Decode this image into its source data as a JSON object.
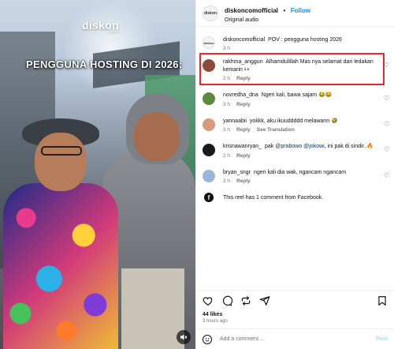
{
  "media": {
    "brand": "diskon",
    "brand_suffix": ".com",
    "overlay_text": "PENGGUNA HOSTING DI 2026:"
  },
  "header": {
    "avatar_text": "diskon",
    "username": "diskoncomofficial",
    "separator": "•",
    "follow_label": "Follow",
    "audio": "Original audio"
  },
  "caption": {
    "avatar_text": "diskon",
    "username": "diskoncomofficial",
    "text": "POV : pengguna hosting 2026",
    "time": "3 h"
  },
  "comments": [
    {
      "username": "rakhma_anggun",
      "text": "Alhamdulillah Mas nya selamat dari ledakan kemarin 👀",
      "time": "2 h",
      "reply": "Reply",
      "translation": "",
      "highlighted": true,
      "avatar_color": "#8a4b3a"
    },
    {
      "username": "novredha_dna",
      "text": "Ngeri kali, bawa sajam 😂😂",
      "time": "3 h",
      "reply": "Reply",
      "translation": "",
      "highlighted": false,
      "avatar_color": "#5d8a3a"
    },
    {
      "username": "yannaabii",
      "text": "yokkk, aku ikuuddddd melawann 🤣",
      "time": "3 h",
      "reply": "Reply",
      "translation": "See Translation",
      "highlighted": false,
      "avatar_color": "#d89a7a"
    },
    {
      "username": "krisnawanryan_",
      "text_before": "pak ",
      "mention1": "@prabowo",
      "mention2": "@jokowi",
      "text_after": ", ini pak di sindir..🔥",
      "time": "2 h",
      "reply": "Reply",
      "translation": "",
      "highlighted": false,
      "avatar_color": "#1a1a1a"
    },
    {
      "username": "bryan_sngr",
      "text": "ngeri kali dia wak, ngancam ngancam",
      "time": "3 h",
      "reply": "Reply",
      "translation": "",
      "highlighted": false,
      "avatar_color": "#9ab7d8"
    }
  ],
  "facebook_note": "This reel has 1 comment from Facebook.",
  "likes": "44 likes",
  "posted_ago": "3 hours ago",
  "add_comment": {
    "placeholder": "Add a comment…",
    "post_label": "Post"
  },
  "colors": {
    "accent": "#0095f6",
    "highlight": "#e8262b"
  }
}
